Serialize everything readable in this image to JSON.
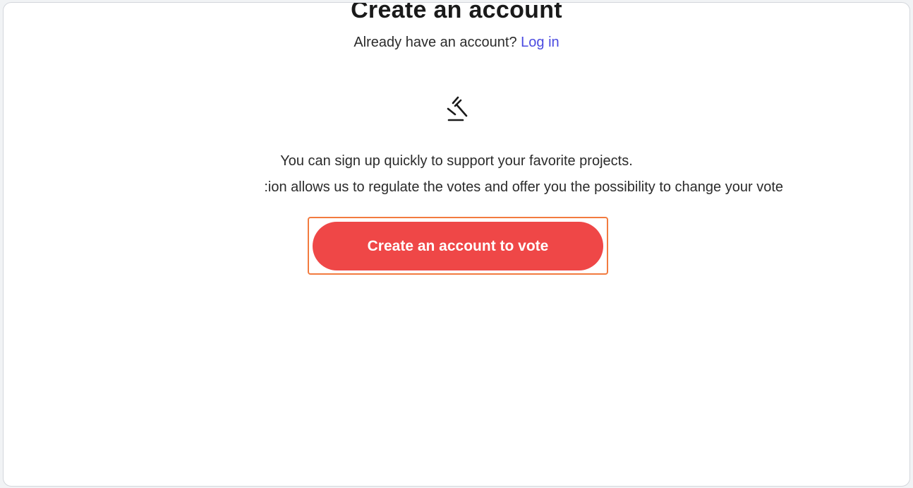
{
  "page": {
    "title": "Create an account",
    "login_prompt": "Already have an account?",
    "login_link": "Log in",
    "icon": "gavel-icon",
    "description_line_1": "You can sign up quickly to support your favorite projects.",
    "description_line_2": ":ion allows us to regulate the votes and offer you the possibility to change your vote",
    "cta_label": "Create an account to vote"
  },
  "colors": {
    "cta_background": "#ef4747",
    "highlight_border": "#f27b3f",
    "link": "#4a4ae0"
  }
}
